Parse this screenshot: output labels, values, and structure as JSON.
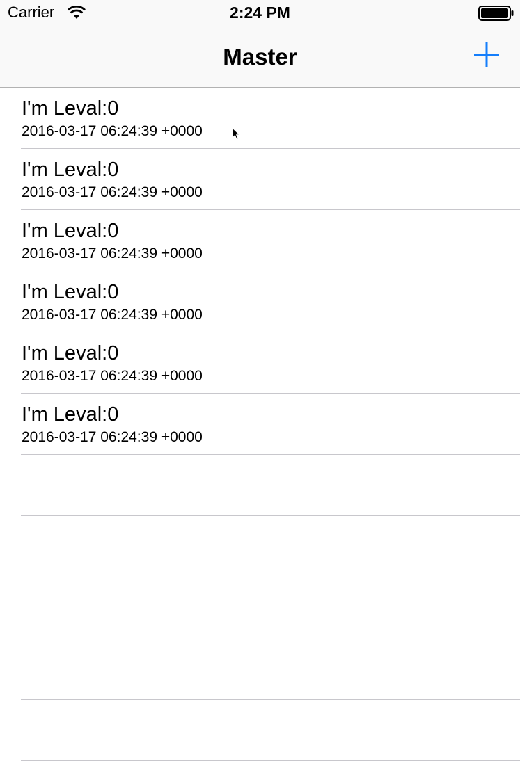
{
  "status_bar": {
    "carrier": "Carrier",
    "time": "2:24 PM",
    "wifi_icon": "wifi-icon",
    "battery_icon": "battery-icon"
  },
  "nav_bar": {
    "title": "Master",
    "add_icon": "plus-icon",
    "accent_color": "#157efb"
  },
  "table": {
    "rows": [
      {
        "title": "I'm Leval:0",
        "subtitle": "2016-03-17 06:24:39 +0000"
      },
      {
        "title": "I'm Leval:0",
        "subtitle": "2016-03-17 06:24:39 +0000"
      },
      {
        "title": "I'm Leval:0",
        "subtitle": "2016-03-17 06:24:39 +0000"
      },
      {
        "title": "I'm Leval:0",
        "subtitle": "2016-03-17 06:24:39 +0000"
      },
      {
        "title": "I'm Leval:0",
        "subtitle": "2016-03-17 06:24:39 +0000"
      },
      {
        "title": "I'm Leval:0",
        "subtitle": "2016-03-17 06:24:39 +0000"
      }
    ]
  }
}
